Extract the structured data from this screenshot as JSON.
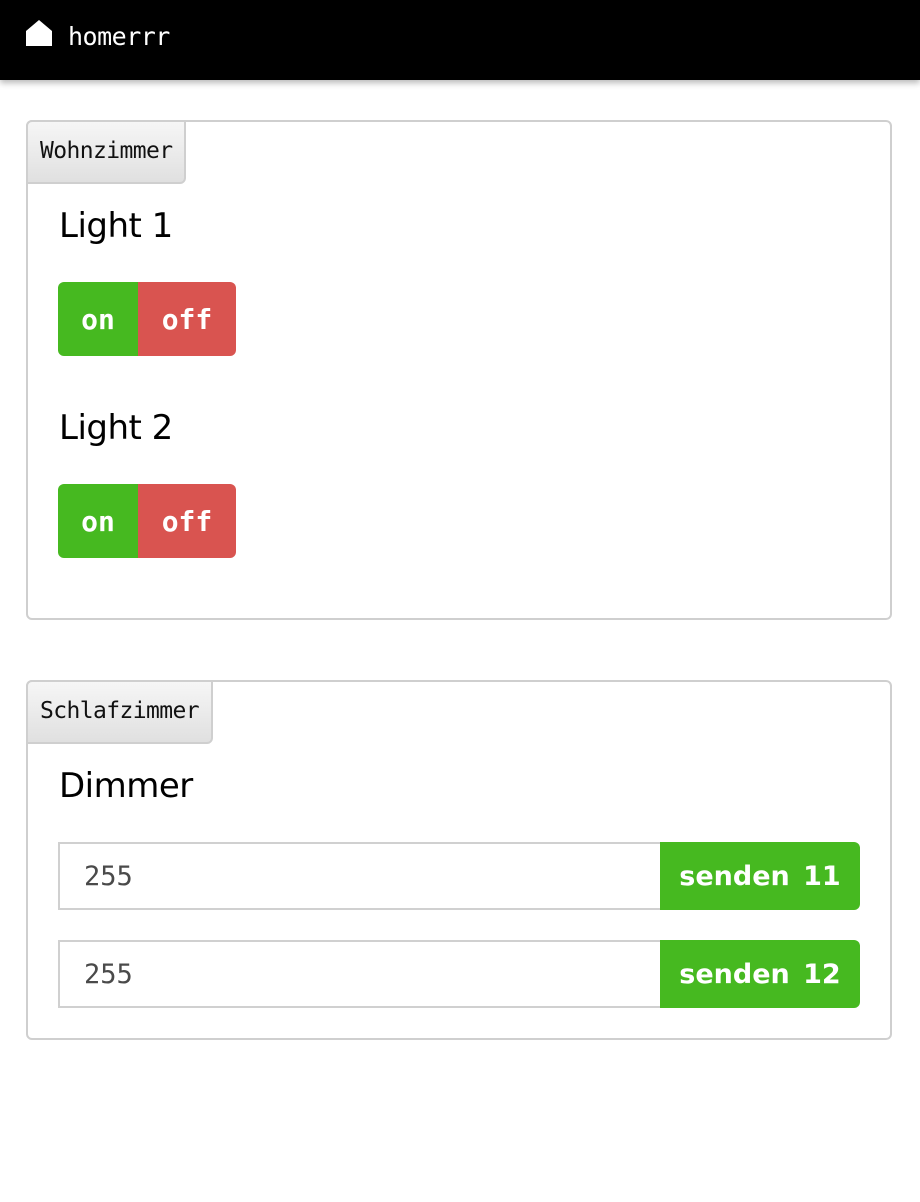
{
  "header": {
    "icon": "home-icon",
    "title": "homerrr"
  },
  "colors": {
    "on": "#46b920",
    "off": "#d95450",
    "send": "#46b920",
    "topbar": "#000000"
  },
  "rooms": [
    {
      "name": "Wohnzimmer",
      "devices": [
        {
          "title": "Light 1",
          "on_label": "on",
          "off_label": "off"
        },
        {
          "title": "Light 2",
          "on_label": "on",
          "off_label": "off"
        }
      ]
    },
    {
      "name": "Schlafzimmer",
      "devices": [
        {
          "title": "Dimmer",
          "channels": [
            {
              "value": "255",
              "send_label": "senden 11"
            },
            {
              "value": "255",
              "send_label": "senden 12"
            }
          ]
        }
      ]
    }
  ]
}
